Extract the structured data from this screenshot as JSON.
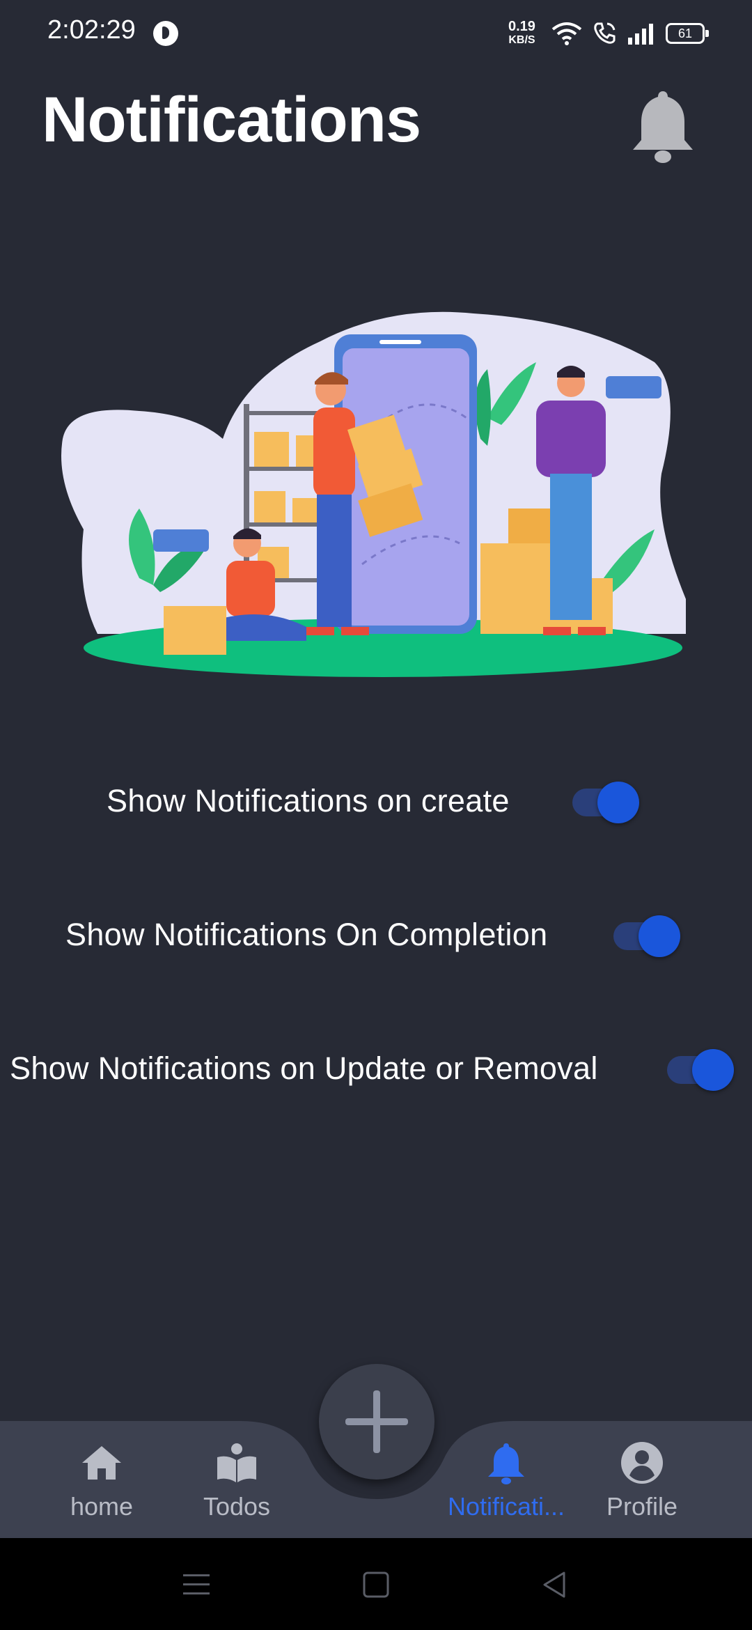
{
  "status_bar": {
    "time": "2:02:29",
    "speed_value": "0.19",
    "speed_unit": "KB/S",
    "battery": "61"
  },
  "header": {
    "title": "Notifications",
    "bell_icon": "bell-icon"
  },
  "settings": [
    {
      "label": "Show Notifications on create",
      "enabled": true
    },
    {
      "label": "Show Notifications On Completion",
      "enabled": true
    },
    {
      "label": "Show Notifications on Update or Removal",
      "enabled": true
    }
  ],
  "bottom_nav": {
    "items": [
      {
        "label": "home",
        "icon": "home-icon",
        "active": false
      },
      {
        "label": "Todos",
        "icon": "book-user-icon",
        "active": false
      },
      {
        "label": "Notificati...",
        "icon": "bell-icon",
        "active": true
      },
      {
        "label": "Profile",
        "icon": "account-icon",
        "active": false
      }
    ],
    "fab_icon": "plus-icon"
  },
  "colors": {
    "background": "#272a35",
    "nav_background": "#3d4150",
    "accent": "#1a56db",
    "active_tab": "#2f6cf0"
  }
}
